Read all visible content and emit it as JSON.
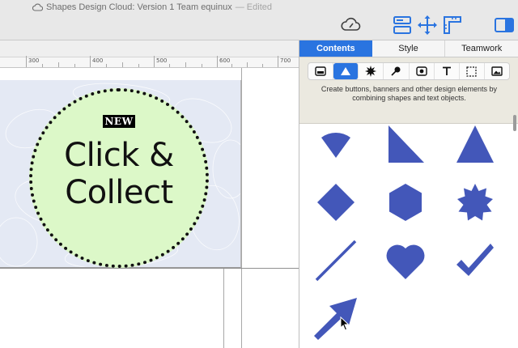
{
  "window": {
    "title": "Shapes Design Cloud: Version 1 Team equinux",
    "status": "— Edited"
  },
  "toolbar": {
    "icons": [
      "cloud-sync-icon",
      "layout-icon",
      "move-icon",
      "ruler-icon",
      "sidebar-toggle-icon"
    ],
    "accent": "#2a74e0"
  },
  "ruler": {
    "labels": [
      "300",
      "400",
      "500",
      "600",
      "700"
    ]
  },
  "canvas": {
    "badge_text": "NEW",
    "headline_line1": "Click &",
    "headline_line2": "Collect",
    "circle_fill": "#dcf8c8",
    "artboard_bg": "#e4e9f4"
  },
  "inspector": {
    "tabs": [
      {
        "label": "Contents",
        "active": true
      },
      {
        "label": "Style",
        "active": false
      },
      {
        "label": "Teamwork",
        "active": false
      }
    ],
    "shape_types": [
      "button-type-icon",
      "shape-type-icon",
      "burst-type-icon",
      "sticker-type-icon",
      "media-type-icon",
      "text-type-icon",
      "selection-type-icon",
      "image-type-icon"
    ],
    "description": "Create buttons, banners and other design elements by combining shapes and text objects.",
    "shapes": [
      "wedge",
      "right-triangle",
      "triangle",
      "diamond",
      "hexagon",
      "star-burst",
      "line",
      "heart",
      "checkmark",
      "arrow"
    ],
    "shape_color": "#4357b9"
  }
}
